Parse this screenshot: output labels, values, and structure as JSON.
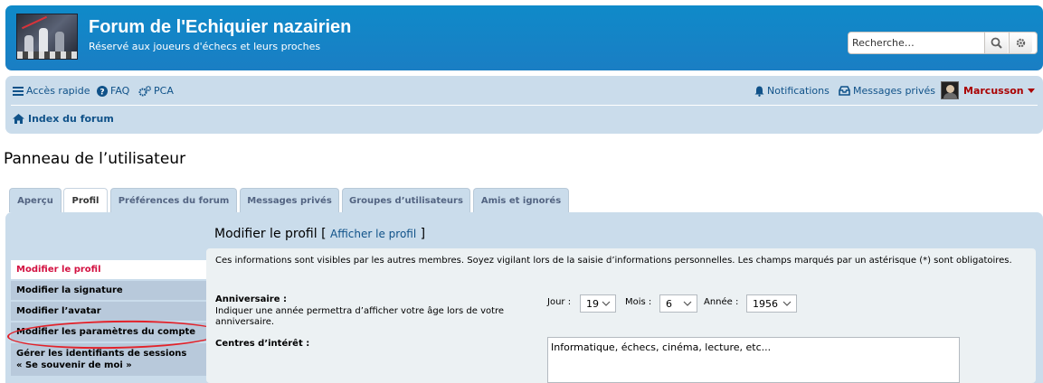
{
  "header": {
    "site_title": "Forum de l'Echiquier nazairien",
    "site_description": "Réservé aux joueurs d'échecs et leurs proches",
    "search_placeholder": "Recherche…",
    "brand_color": "#0f8ac9"
  },
  "navbar": {
    "quick_links": "Accès rapide",
    "faq": "FAQ",
    "acp": "PCA",
    "notifications": "Notifications",
    "private_messages": "Messages privés",
    "username": "Marcusson",
    "breadcrumb": "Index du forum",
    "username_color": "#aa0000"
  },
  "page_title": "Panneau de l’utilisateur",
  "tabs": [
    {
      "label": "Aperçu",
      "active": false
    },
    {
      "label": "Profil",
      "active": true
    },
    {
      "label": "Préférences du forum",
      "active": false
    },
    {
      "label": "Messages privés",
      "active": false
    },
    {
      "label": "Groupes d’utilisateurs",
      "active": false
    },
    {
      "label": "Amis et ignorés",
      "active": false
    }
  ],
  "side_menu": [
    {
      "label": "Modifier le profil",
      "active": true
    },
    {
      "label": "Modifier la signature",
      "active": false
    },
    {
      "label": "Modifier l’avatar",
      "active": false
    },
    {
      "label": "Modifier les paramètres du compte",
      "active": false
    },
    {
      "label_line1": "Gérer les identifiants de sessions",
      "label_line2": "« Se souvenir de moi »",
      "active": false
    }
  ],
  "content": {
    "title": "Modifier le profil",
    "title_link_open": "[",
    "title_link": "Afficher le profil",
    "title_link_close": "]",
    "intro": "Ces informations sont visibles par les autres membres. Soyez vigilant lors de la saisie d’informations personnelles. Les champs marqués par un astérisque (*) sont obligatoires.",
    "birthday": {
      "label": "Anniversaire :",
      "hint": "Indiquer une année permettra d’afficher votre âge lors de votre anniversaire.",
      "day_label": "Jour :",
      "day_value": "19",
      "month_label": "Mois :",
      "month_value": "6",
      "year_label": "Année :",
      "year_value": "1956"
    },
    "interests": {
      "label": "Centres d’intérêt :",
      "value": "Informatique, échecs, cinéma, lecture, etc..."
    }
  }
}
